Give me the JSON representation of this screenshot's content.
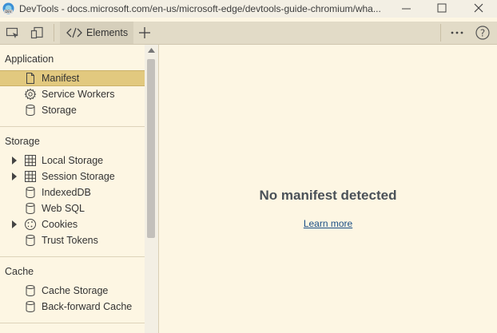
{
  "window": {
    "title": "DevTools - docs.microsoft.com/en-us/microsoft-edge/devtools-guide-chromium/wha...",
    "icon": "edge-dev-icon"
  },
  "toolbar": {
    "tabs": [
      {
        "label": "Elements",
        "icon": "code-icon"
      }
    ]
  },
  "sidebar": {
    "sections": [
      {
        "title": "Application",
        "items": [
          {
            "label": "Manifest",
            "icon": "document-icon",
            "selected": true
          },
          {
            "label": "Service Workers",
            "icon": "gear-icon"
          },
          {
            "label": "Storage",
            "icon": "database-icon"
          }
        ]
      },
      {
        "title": "Storage",
        "items": [
          {
            "label": "Local Storage",
            "icon": "grid-icon",
            "expandable": true
          },
          {
            "label": "Session Storage",
            "icon": "grid-icon",
            "expandable": true
          },
          {
            "label": "IndexedDB",
            "icon": "database-icon"
          },
          {
            "label": "Web SQL",
            "icon": "database-icon"
          },
          {
            "label": "Cookies",
            "icon": "cookie-icon",
            "expandable": true
          },
          {
            "label": "Trust Tokens",
            "icon": "database-icon"
          }
        ]
      },
      {
        "title": "Cache",
        "items": [
          {
            "label": "Cache Storage",
            "icon": "database-icon"
          },
          {
            "label": "Back-forward Cache",
            "icon": "database-icon"
          }
        ]
      }
    ]
  },
  "main": {
    "message": "No manifest detected",
    "link": "Learn more"
  },
  "colors": {
    "background": "#fdf6e3",
    "selected": "#e2c97f",
    "toolbar": "#e2dbc7",
    "link": "#1a4f86"
  }
}
